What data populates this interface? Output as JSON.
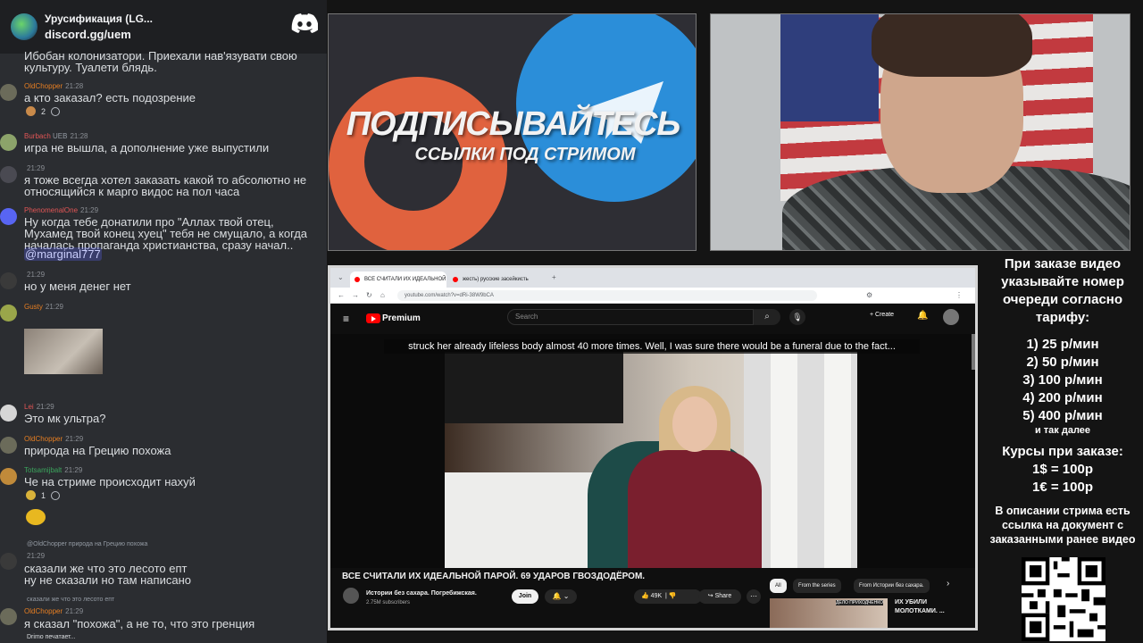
{
  "discord": {
    "server_name": "Урусификация (LG...",
    "invite": "discord.gg/uem",
    "typing": "Drimo печатает..."
  },
  "chat": {
    "cut_top": "Ибобан колонизатори. Приехали нав'язувати свою культуру. Туалети блядь.",
    "messages": [
      {
        "nick": "OldChopper",
        "time": "21:28",
        "text": "а кто заказал? есть подозрение",
        "reaction_count": "2"
      },
      {
        "nick": "Burbach",
        "tag": "UEB",
        "time": "21:28",
        "text": "игра не вышла, а дополнение уже выпустили"
      },
      {
        "nick": "",
        "time": "21:29",
        "text": "я тоже всегда хотел заказать какой то абсолютно не относящийся к марго видос на пол часа"
      },
      {
        "nick": "PhenomenalOne",
        "time": "21:29",
        "text": "Ну когда тебе донатили про \"Аллах твой отец, Мухамед твой конец хуец\" тебя не смущало, а когда началась пропаганда христианства, сразу начал..",
        "mention": "@marginal777"
      },
      {
        "nick": "",
        "time": "21:29",
        "text": "но у меня денег нет"
      },
      {
        "nick": "Gusty",
        "time": "21:29",
        "text": ""
      },
      {
        "nick": "Lei",
        "time": "21:29",
        "text": "Это мк ультра?"
      },
      {
        "nick": "OldChopper",
        "time": "21:29",
        "text": "природа на Грецию похожа"
      },
      {
        "nick": "Totsamijbalt",
        "time": "21:29",
        "text": "Че на стриме происходит нахуй",
        "reaction_count": "1"
      },
      {
        "reply": "@OldChopper природа на Грецию похожа",
        "nick": "",
        "time": "21:29",
        "text": "сказали же что это лесото епт\nну не сказали но там написано"
      },
      {
        "reply": "сказали же что это лесото епт",
        "nick": "OldChopper",
        "time": "21:29",
        "text": "я сказал \"похожа\", а не то, что это гренция"
      }
    ]
  },
  "promo": {
    "title": "ПОДПИСЫВАЙТЕСЬ",
    "subtitle": "ССЫЛКИ ПОД СТРИМОМ"
  },
  "browser": {
    "tab1": "ВСЕ СЧИТАЛИ ИХ ИДЕАЛЬНОЙ",
    "tab2": "жесть) русские засейкисть",
    "url": "youtube.com/watch?v=dRi-38W9bCA",
    "yt_brand": "Premium",
    "search_placeholder": "Search",
    "create": "Create",
    "caption": "struck her already lifeless body almost 40 more times. Well, I was sure there would be a funeral due to the fact...",
    "video_title": "ВСЕ СЧИТАЛИ ИХ ИДЕАЛЬНОЙ ПАРОЙ. 69 УДАРОВ ГВОЗДОДЁРОМ.",
    "channel": "Истории без сахара. Погребижская.",
    "subs": "2.75M subscribers",
    "join": "Join",
    "likes": "49K",
    "share": "Share",
    "chips": [
      "All",
      "From the series",
      "From Истории без сахара."
    ],
    "rec_label": "ДЕЛО ПРИХОДЧЕНКО",
    "rec_title": "ИХ УБИЛИ МОЛОТКАМИ. ..."
  },
  "rules": {
    "intro": "При заказе видео указывайте номер очереди согласно тарифу:",
    "tariffs": [
      "1) 25 р/мин",
      "2) 50 р/мин",
      "3) 100 р/мин",
      "4) 200 р/мин",
      "5) 400 р/мин"
    ],
    "etc": "и так далее",
    "rates_title": "Курсы при заказе:",
    "rate1": "1$ = 100р",
    "rate2": "1€ = 100р",
    "note": "В описании стрима есть ссылка на документ с заказанными ранее видео"
  }
}
